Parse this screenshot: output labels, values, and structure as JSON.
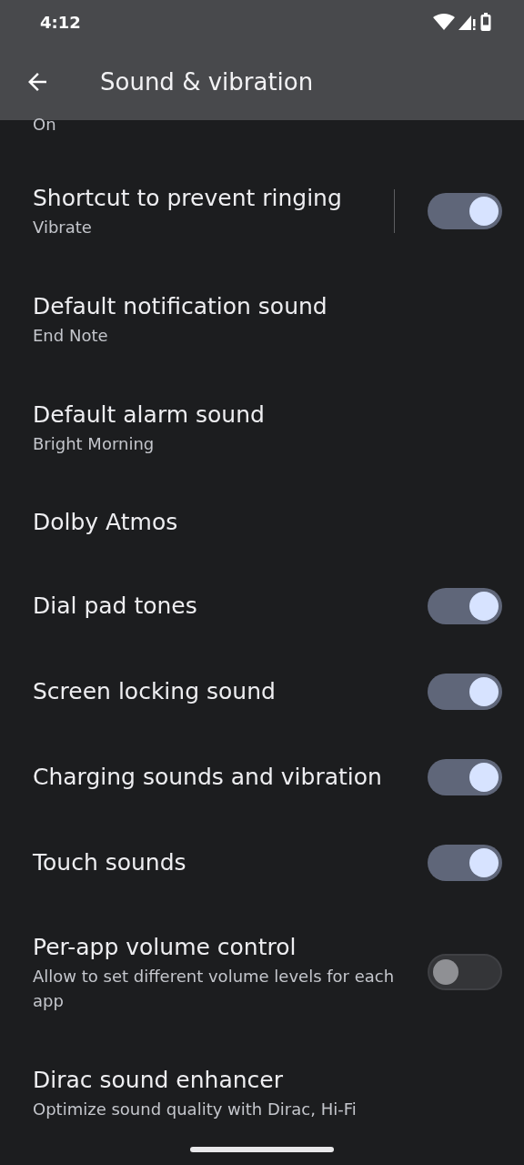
{
  "status_bar": {
    "time": "4:12"
  },
  "app_bar": {
    "title": "Sound & vibration"
  },
  "top_summary": "On",
  "rows": [
    {
      "kind": "toggle",
      "title": "Shortcut to prevent ringing",
      "summary": "Vibrate",
      "on": true,
      "divider": true
    },
    {
      "kind": "plain",
      "title": "Default notification sound",
      "summary": "End Note"
    },
    {
      "kind": "plain",
      "title": "Default alarm sound",
      "summary": "Bright Morning"
    },
    {
      "kind": "plain",
      "title": "Dolby Atmos"
    },
    {
      "kind": "toggle",
      "title": "Dial pad tones",
      "on": true,
      "divider": false
    },
    {
      "kind": "toggle",
      "title": "Screen locking sound",
      "on": true,
      "divider": false
    },
    {
      "kind": "toggle",
      "title": "Charging sounds and vibration",
      "on": true,
      "divider": false
    },
    {
      "kind": "toggle",
      "title": "Touch sounds",
      "on": true,
      "divider": false
    },
    {
      "kind": "toggle",
      "title": "Per-app volume control",
      "summary": "Allow to set different volume levels for each app",
      "on": false,
      "divider": false
    },
    {
      "kind": "plain",
      "title": "Dirac sound enhancer",
      "summary": "Optimize sound quality with Dirac, Hi-Fi"
    }
  ]
}
